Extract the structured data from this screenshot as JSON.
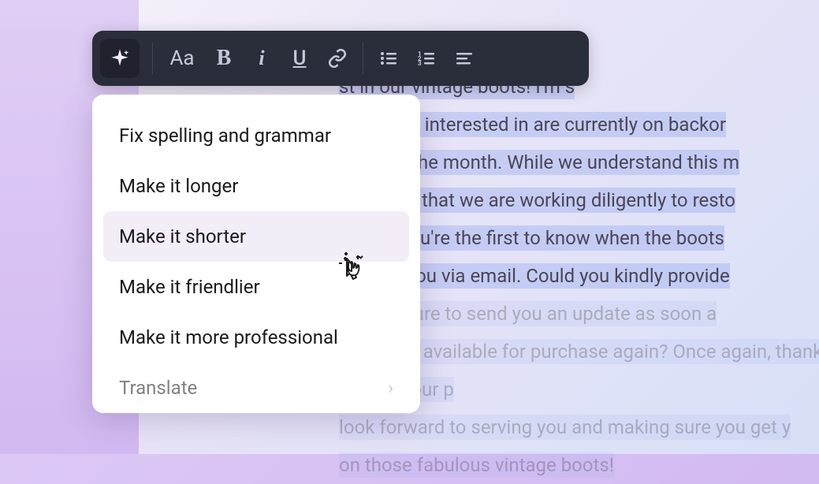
{
  "text_editor": {
    "lines": [
      "st in our vintage boots! I'm s",
      "ots you're interested in are currently on backor",
      "e end of the month. While we understand this m",
      "t assured that we are working diligently to resto",
      "ensure you're the first to know when the boots",
      "o notify you via email. Could you kindly provide",
      "ll make sure to send you an update as soon a",
      "boots are available for purchase again? Once again, thank you for your p",
      "look forward to serving you and making sure you get y",
      "on those fabulous vintage boots!"
    ]
  },
  "toolbar": {
    "font_label": "Aa"
  },
  "dropdown": {
    "items": [
      {
        "label": "Fix spelling and grammar",
        "hovered": false,
        "has_submenu": false
      },
      {
        "label": "Make it longer",
        "hovered": false,
        "has_submenu": false
      },
      {
        "label": "Make it shorter",
        "hovered": true,
        "has_submenu": false
      },
      {
        "label": "Make it friendlier",
        "hovered": false,
        "has_submenu": false
      },
      {
        "label": "Make it more professional",
        "hovered": false,
        "has_submenu": false
      },
      {
        "label": "Translate",
        "hovered": false,
        "has_submenu": true
      }
    ]
  }
}
